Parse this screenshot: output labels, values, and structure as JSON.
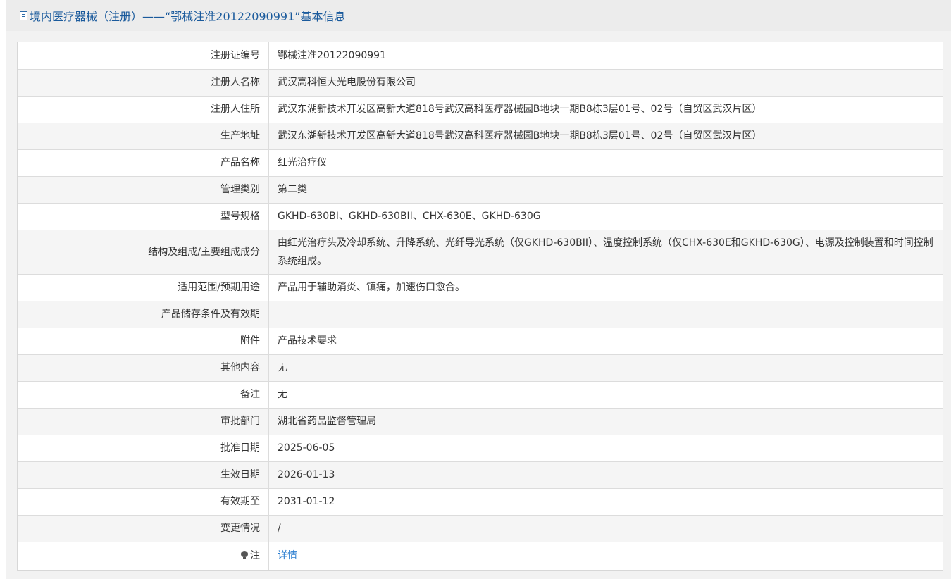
{
  "header": {
    "title": "境内医疗器械（注册）——“鄂械注准20122090991”基本信息",
    "icon": "document-icon"
  },
  "rows": [
    {
      "label": "注册证编号",
      "value": "鄂械注准20122090991"
    },
    {
      "label": "注册人名称",
      "value": "武汉高科恒大光电股份有限公司"
    },
    {
      "label": "注册人住所",
      "value": "武汉东湖新技术开发区高新大道818号武汉高科医疗器械园B地块一期B8栋3层01号、02号（自贸区武汉片区）"
    },
    {
      "label": "生产地址",
      "value": "武汉东湖新技术开发区高新大道818号武汉高科医疗器械园B地块一期B8栋3层01号、02号（自贸区武汉片区）"
    },
    {
      "label": "产品名称",
      "value": "红光治疗仪"
    },
    {
      "label": "管理类别",
      "value": "第二类"
    },
    {
      "label": "型号规格",
      "value": "GKHD-630BI、GKHD-630BII、CHX-630E、GKHD-630G"
    },
    {
      "label": "结构及组成/主要组成成分",
      "value": "由红光治疗头及冷却系统、升降系统、光纤导光系统（仅GKHD-630BII）、温度控制系统（仅CHX-630E和GKHD-630G）、电源及控制装置和时间控制系统组成。"
    },
    {
      "label": "适用范围/预期用途",
      "value": "产品用于辅助消炎、镇痛，加速伤口愈合。"
    },
    {
      "label": "产品储存条件及有效期",
      "value": ""
    },
    {
      "label": "附件",
      "value": "产品技术要求"
    },
    {
      "label": "其他内容",
      "value": "无"
    },
    {
      "label": "备注",
      "value": "无"
    },
    {
      "label": "审批部门",
      "value": "湖北省药品监督管理局"
    },
    {
      "label": "批准日期",
      "value": "2025-06-05"
    },
    {
      "label": "生效日期",
      "value": "2026-01-13"
    },
    {
      "label": "有效期至",
      "value": "2031-01-12"
    },
    {
      "label": "变更情况",
      "value": "/"
    }
  ],
  "note": {
    "label": "注",
    "icon": "lightbulb-icon",
    "link_text": "详情"
  },
  "colors": {
    "title": "#1a5a9c",
    "link": "#2d7fd0",
    "row_shade": "#f5f5f5"
  }
}
